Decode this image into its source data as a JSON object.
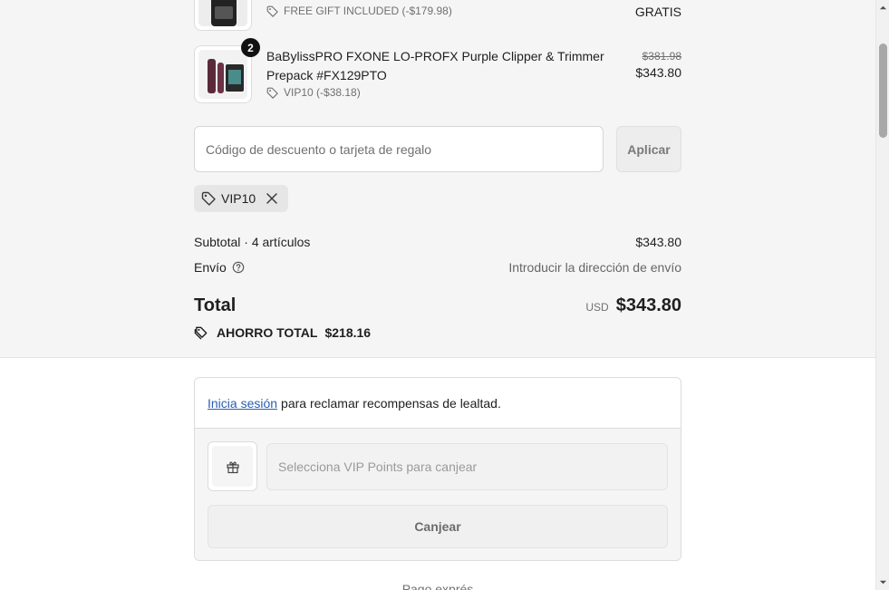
{
  "products": [
    {
      "discount": "FREE GIFT INCLUDED (-$179.98)",
      "price": "GRATIS"
    },
    {
      "qty": "2",
      "name_line1": "BaBylissPRO FXONE LO-PROFX Purple Clipper & Trimmer",
      "name_line2": "Prepack #FX129PTO",
      "discount": "VIP10 (-$38.18)",
      "original_price": "$381.98",
      "price": "$343.80"
    }
  ],
  "discount_form": {
    "placeholder": "Código de descuento o tarjeta de regalo",
    "apply_label": "Aplicar"
  },
  "applied_code": "VIP10",
  "summary": {
    "subtotal_label": "Subtotal · 4 artículos",
    "subtotal_value": "$343.80",
    "shipping_label": "Envío",
    "shipping_value": "Introducir la dirección de envío",
    "total_label": "Total",
    "currency": "USD",
    "total_value": "$343.80",
    "savings_label": "AHORRO TOTAL",
    "savings_value": "$218.16"
  },
  "loyalty": {
    "login_link": "Inicia sesión",
    "login_text": "para reclamar recompensas de lealtad.",
    "points_placeholder": "Selecciona VIP Points para canjear",
    "redeem_label": "Canjear"
  },
  "express_checkout": "Pago exprés",
  "colors": {
    "summary_bg": "#f5f5f5",
    "link": "#2a5db0",
    "badge": "#111111"
  }
}
